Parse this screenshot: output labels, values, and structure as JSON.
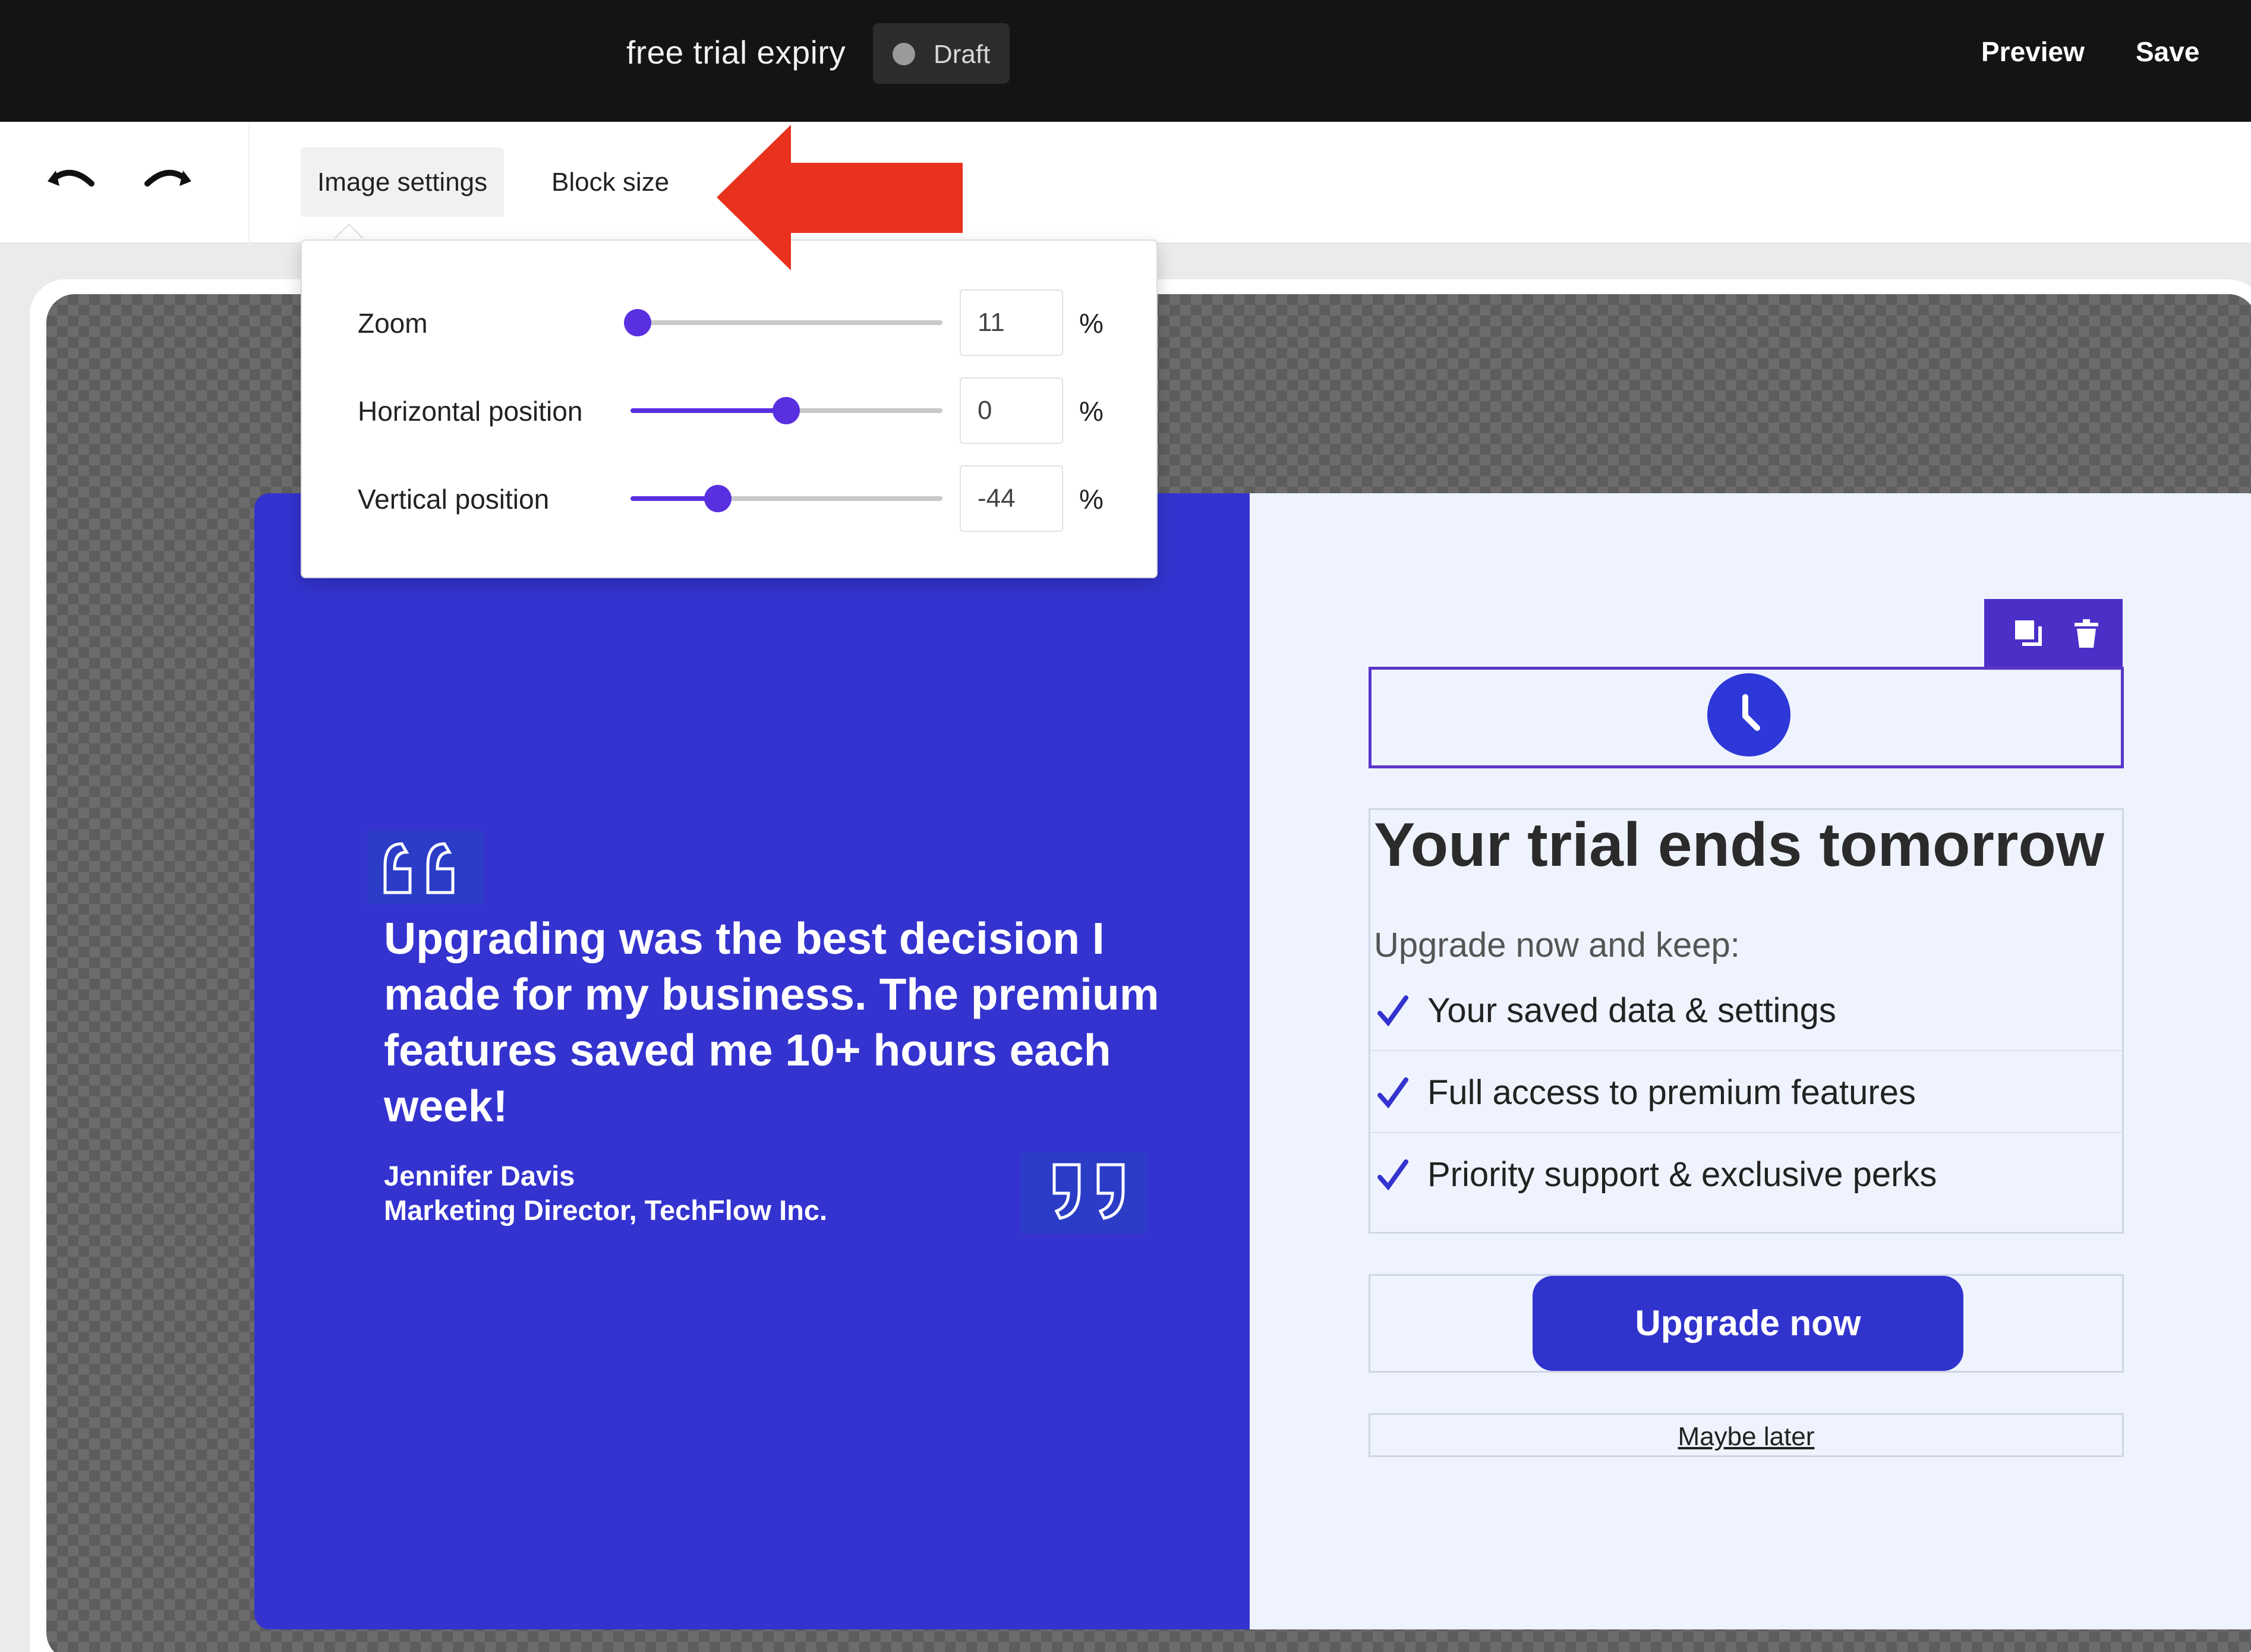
{
  "header": {
    "document_title": "free trial expiry",
    "status_label": "Draft",
    "preview_label": "Preview",
    "save_label": "Save"
  },
  "toolbar": {
    "undo_icon": "undo-icon",
    "redo_icon": "redo-icon",
    "tabs": [
      {
        "label": "Image settings",
        "active": true
      },
      {
        "label": "Block size",
        "active": false
      }
    ]
  },
  "image_settings": {
    "zoom": {
      "label": "Zoom",
      "value": "11",
      "unit": "%"
    },
    "horizontal": {
      "label": "Horizontal position",
      "value": "0",
      "unit": "%"
    },
    "vertical": {
      "label": "Vertical position",
      "value": "-44",
      "unit": "%"
    }
  },
  "email": {
    "testimonial": {
      "quote": "Upgrading was the best decision I made for my business. The premium features saved me 10+ hours each week!",
      "author_name": "Jennifer Davis",
      "author_title": "Marketing Director, TechFlow Inc."
    },
    "headline": "Your trial ends tomorrow",
    "subheadline": "Upgrade now and keep:",
    "features": [
      "Your saved data & settings",
      "Full access to premium features",
      "Priority support & exclusive perks"
    ],
    "cta_label": "Upgrade now",
    "secondary_label": "Maybe later"
  },
  "colors": {
    "brand_blue": "#3433cf",
    "accent_purple": "#5a2fe0",
    "annotation_red": "#e8321e"
  }
}
